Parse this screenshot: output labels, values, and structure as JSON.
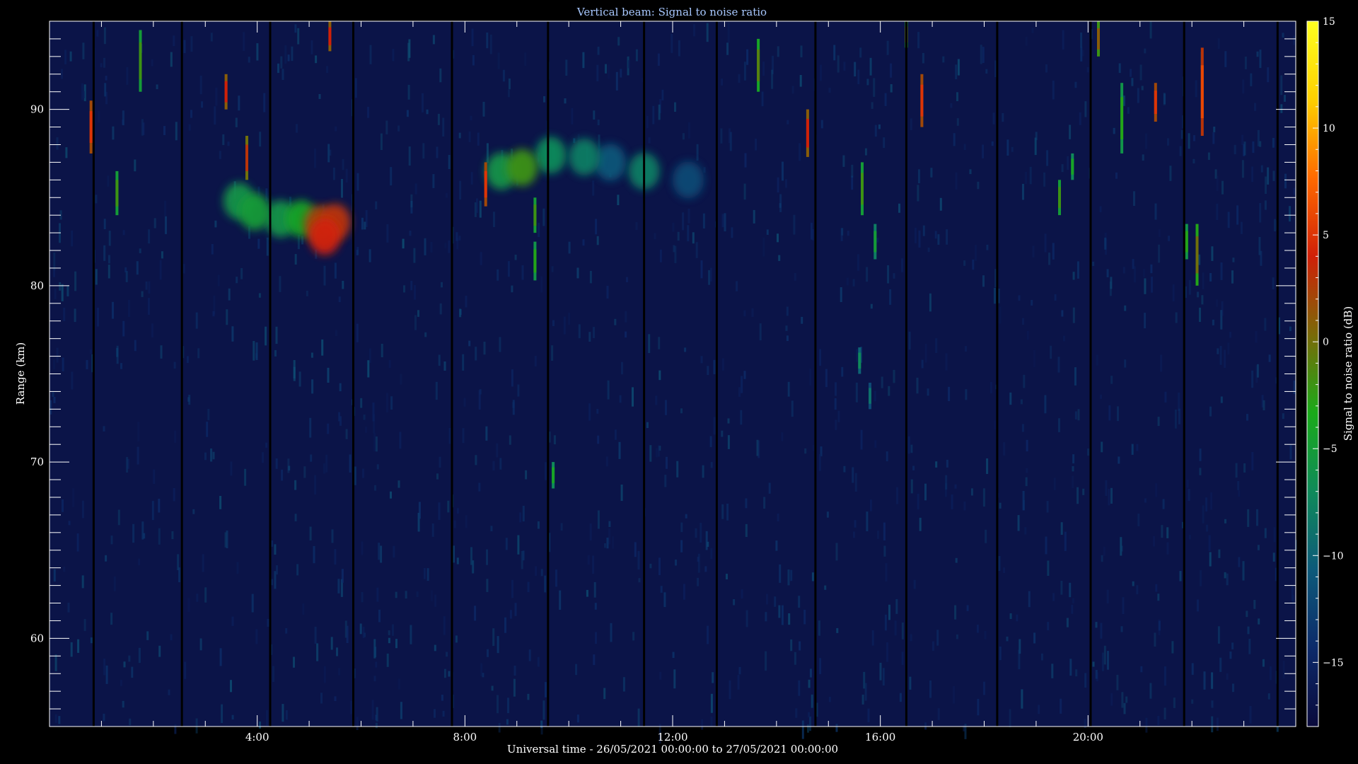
{
  "chart_data": {
    "type": "heatmap",
    "title": "Vertical beam: Signal to noise ratio",
    "xlabel": "Universal time - 26/05/2021 00:00:00 to 27/05/2021 00:00:00",
    "ylabel": "Range (km)",
    "colorbar_label": "Signal to noise ratio (dB)",
    "xlim_hours": [
      0,
      24
    ],
    "ylim_km": [
      55,
      95
    ],
    "zlim_db": [
      -18,
      15
    ],
    "x_ticks": [
      {
        "hour": 4,
        "label": "4:00"
      },
      {
        "hour": 8,
        "label": "8:00"
      },
      {
        "hour": 12,
        "label": "12:00"
      },
      {
        "hour": 16,
        "label": "16:00"
      },
      {
        "hour": 20,
        "label": "20:00"
      }
    ],
    "y_ticks": [
      {
        "km": 60,
        "label": "60"
      },
      {
        "km": 70,
        "label": "70"
      },
      {
        "km": 80,
        "label": "80"
      },
      {
        "km": 90,
        "label": "90"
      }
    ],
    "colorbar_ticks": [
      {
        "db": 15,
        "label": "15"
      },
      {
        "db": 10,
        "label": "10"
      },
      {
        "db": 5,
        "label": "5"
      },
      {
        "db": 0,
        "label": "0"
      },
      {
        "db": -5,
        "label": "−5"
      },
      {
        "db": -10,
        "label": "−10"
      },
      {
        "db": -15,
        "label": "−15"
      }
    ],
    "colormap": [
      "#0a0a3c",
      "#0c2a6a",
      "#0d5a7a",
      "#0f8a5a",
      "#1aaa1a",
      "#7a6a08",
      "#d02008",
      "#ff6a00",
      "#ffd000",
      "#ffff20"
    ],
    "background_color": "#0b1448",
    "data_gaps_hours": [
      0.85,
      2.55,
      4.25,
      5.85,
      7.75,
      9.6,
      11.45,
      12.85,
      14.75,
      16.5,
      18.25,
      20.05,
      21.85,
      23.65
    ],
    "echo_blobs": [
      {
        "hour": 3.65,
        "km": 84.8,
        "db": -6
      },
      {
        "hour": 3.95,
        "km": 84.2,
        "db": -5
      },
      {
        "hour": 4.45,
        "km": 83.8,
        "db": -6
      },
      {
        "hour": 4.85,
        "km": 83.8,
        "db": -4
      },
      {
        "hour": 5.2,
        "km": 83.5,
        "db": 2
      },
      {
        "hour": 5.5,
        "km": 83.6,
        "db": 3
      },
      {
        "hour": 5.3,
        "km": 82.8,
        "db": 4
      },
      {
        "hour": 8.7,
        "km": 86.5,
        "db": -6
      },
      {
        "hour": 9.1,
        "km": 86.7,
        "db": -2
      },
      {
        "hour": 9.65,
        "km": 87.4,
        "db": -7
      },
      {
        "hour": 10.3,
        "km": 87.3,
        "db": -8
      },
      {
        "hour": 10.8,
        "km": 87.0,
        "db": -11
      },
      {
        "hour": 11.45,
        "km": 86.5,
        "db": -8
      },
      {
        "hour": 12.3,
        "km": 86.0,
        "db": -12
      }
    ],
    "meteor_streaks": [
      {
        "hour": 0.8,
        "km_top": 90.5,
        "km_bottom": 87.5,
        "db": 2
      },
      {
        "hour": 1.3,
        "km_top": 86.5,
        "km_bottom": 84.0,
        "db": -5
      },
      {
        "hour": 1.75,
        "km_top": 94.5,
        "km_bottom": 91.0,
        "db": -5
      },
      {
        "hour": 3.4,
        "km_top": 92.0,
        "km_bottom": 90.0,
        "db": 1
      },
      {
        "hour": 3.8,
        "km_top": 88.5,
        "km_bottom": 86.0,
        "db": 0
      },
      {
        "hour": 5.4,
        "km_top": 95.0,
        "km_bottom": 93.3,
        "db": 1
      },
      {
        "hour": 8.4,
        "km_top": 87.0,
        "km_bottom": 84.5,
        "db": 2
      },
      {
        "hour": 9.35,
        "km_top": 85.0,
        "km_bottom": 83.0,
        "db": -5
      },
      {
        "hour": 9.35,
        "km_top": 82.5,
        "km_bottom": 80.3,
        "db": -6
      },
      {
        "hour": 9.7,
        "km_top": 70.0,
        "km_bottom": 68.5,
        "db": -7
      },
      {
        "hour": 13.65,
        "km_top": 94.0,
        "km_bottom": 91.0,
        "db": -4
      },
      {
        "hour": 14.6,
        "km_top": 90.0,
        "km_bottom": 87.3,
        "db": 1
      },
      {
        "hour": 15.65,
        "km_top": 87.0,
        "km_bottom": 84.0,
        "db": -5
      },
      {
        "hour": 15.9,
        "km_top": 83.5,
        "km_bottom": 81.5,
        "db": -8
      },
      {
        "hour": 16.5,
        "km_top": 95.0,
        "km_bottom": 93.5,
        "db": -3
      },
      {
        "hour": 16.8,
        "km_top": 92.0,
        "km_bottom": 89.0,
        "db": 2
      },
      {
        "hour": 19.45,
        "km_top": 86.0,
        "km_bottom": 84.0,
        "db": -5
      },
      {
        "hour": 19.7,
        "km_top": 87.5,
        "km_bottom": 86.0,
        "db": -7
      },
      {
        "hour": 20.2,
        "km_top": 95.0,
        "km_bottom": 93.0,
        "db": -2
      },
      {
        "hour": 20.65,
        "km_top": 91.5,
        "km_bottom": 87.5,
        "db": -6
      },
      {
        "hour": 21.3,
        "km_top": 91.5,
        "km_bottom": 89.3,
        "db": 2
      },
      {
        "hour": 21.9,
        "km_top": 83.5,
        "km_bottom": 81.5,
        "db": -6
      },
      {
        "hour": 22.1,
        "km_top": 83.5,
        "km_bottom": 80.0,
        "db": -3
      },
      {
        "hour": 22.2,
        "km_top": 93.5,
        "km_bottom": 88.5,
        "db": 3
      },
      {
        "hour": 15.6,
        "km_top": 76.5,
        "km_bottom": 75.0,
        "db": -10
      },
      {
        "hour": 15.8,
        "km_top": 74.5,
        "km_bottom": 73.0,
        "db": -12
      }
    ]
  }
}
